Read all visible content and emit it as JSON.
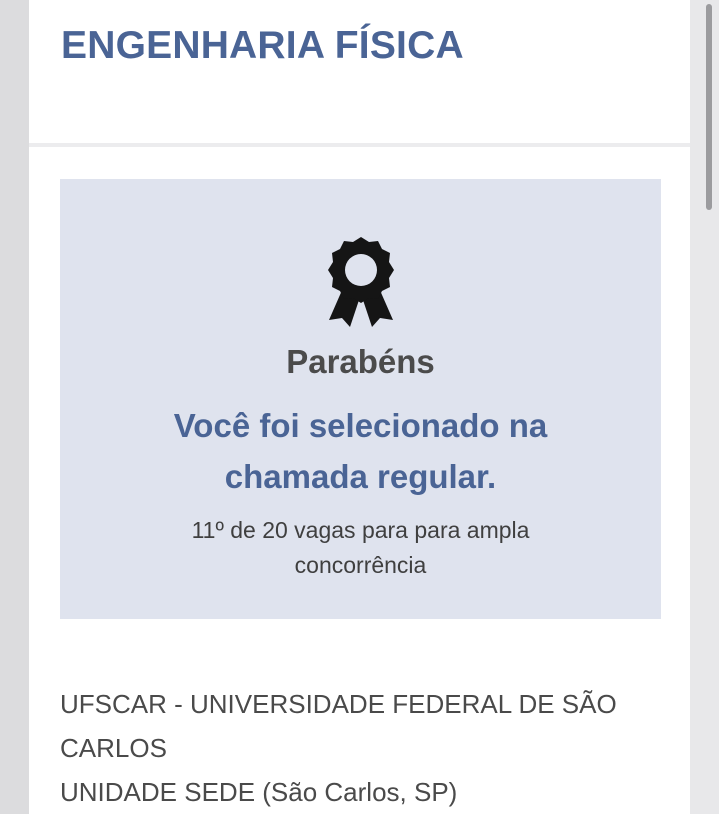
{
  "course": {
    "title": "ENGENHARIA FÍSICA"
  },
  "result": {
    "icon": "award-ribbon-icon",
    "congrats": "Parabéns",
    "message": "Você foi selecionado na chamada regular.",
    "rank_info": "11º de 20 vagas para para ampla concorrência"
  },
  "institution": {
    "name": "UFSCAR - UNIVERSIDADE FEDERAL DE SÃO CARLOS",
    "unit": "UNIDADE SEDE (São Carlos, SP)"
  },
  "colors": {
    "accent": "#4a6495",
    "result_background": "#dfe3ee",
    "text_dark": "#4b4b4b"
  }
}
